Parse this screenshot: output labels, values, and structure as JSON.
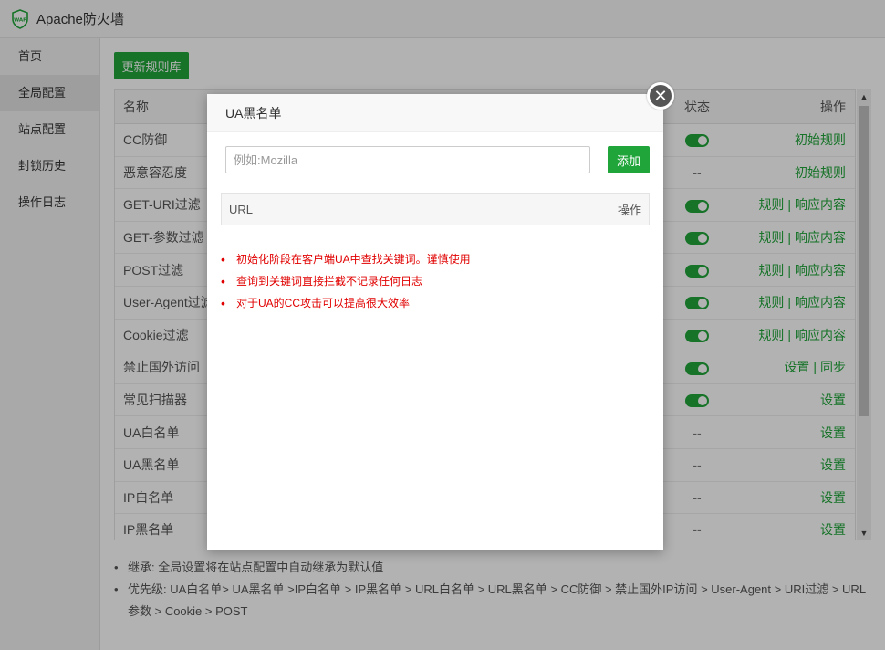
{
  "app": {
    "title": "Apache防火墙",
    "logo_icon": "waf-shield-logo"
  },
  "sidebar": {
    "items": [
      {
        "label": "首页",
        "active": false
      },
      {
        "label": "全局配置",
        "active": true
      },
      {
        "label": "站点配置",
        "active": false
      },
      {
        "label": "封锁历史",
        "active": false
      },
      {
        "label": "操作日志",
        "active": false
      }
    ]
  },
  "toolbar": {
    "update_label": "更新规则库"
  },
  "table": {
    "headers": {
      "name": "名称",
      "status": "状态",
      "ops": "操作"
    },
    "rows": [
      {
        "name": "CC防御",
        "status": "on",
        "ops": [
          "初始规则"
        ]
      },
      {
        "name": "恶意容忍度",
        "status": "--",
        "ops": [
          "初始规则"
        ]
      },
      {
        "name": "GET-URI过滤",
        "status": "on",
        "ops": [
          "规则",
          "响应内容"
        ]
      },
      {
        "name": "GET-参数过滤",
        "status": "on",
        "ops": [
          "规则",
          "响应内容"
        ]
      },
      {
        "name": "POST过滤",
        "status": "on",
        "ops": [
          "规则",
          "响应内容"
        ]
      },
      {
        "name": "User-Agent过滤",
        "status": "on",
        "ops": [
          "规则",
          "响应内容"
        ]
      },
      {
        "name": "Cookie过滤",
        "status": "on",
        "ops": [
          "规则",
          "响应内容"
        ]
      },
      {
        "name": "禁止国外访问",
        "status": "on",
        "ops": [
          "设置",
          "同步"
        ]
      },
      {
        "name": "常见扫描器",
        "status": "on",
        "ops": [
          "设置"
        ]
      },
      {
        "name": "UA白名单",
        "status": "--",
        "ops": [
          "设置"
        ]
      },
      {
        "name": "UA黑名单",
        "status": "--",
        "ops": [
          "设置"
        ]
      },
      {
        "name": "IP白名单",
        "status": "--",
        "ops": [
          "设置"
        ]
      },
      {
        "name": "IP黑名单",
        "status": "--",
        "ops": [
          "设置"
        ]
      }
    ]
  },
  "notes": [
    "继承: 全局设置将在站点配置中自动继承为默认值",
    "优先级: UA白名单> UA黑名单 >IP白名单 > IP黑名单 > URL白名单 > URL黑名单 > CC防御 > 禁止国外IP访问 > User-Agent > URI过滤 > URL参数 > Cookie > POST"
  ],
  "dialog": {
    "title": "UA黑名单",
    "input_placeholder": "例如:Mozilla",
    "input_value": "",
    "add_label": "添加",
    "table_headers": {
      "url": "URL",
      "ops": "操作"
    },
    "tips": [
      "初始化阶段在客户端UA中查找关键词。谨慎使用",
      "查询到关键词直接拦截不记录任何日志",
      "对于UA的CC攻击可以提高很大效率"
    ]
  },
  "colors": {
    "accent": "#20a53a",
    "warning_text": "#e10000",
    "overlay": "rgba(0,0,0,0.3)"
  }
}
